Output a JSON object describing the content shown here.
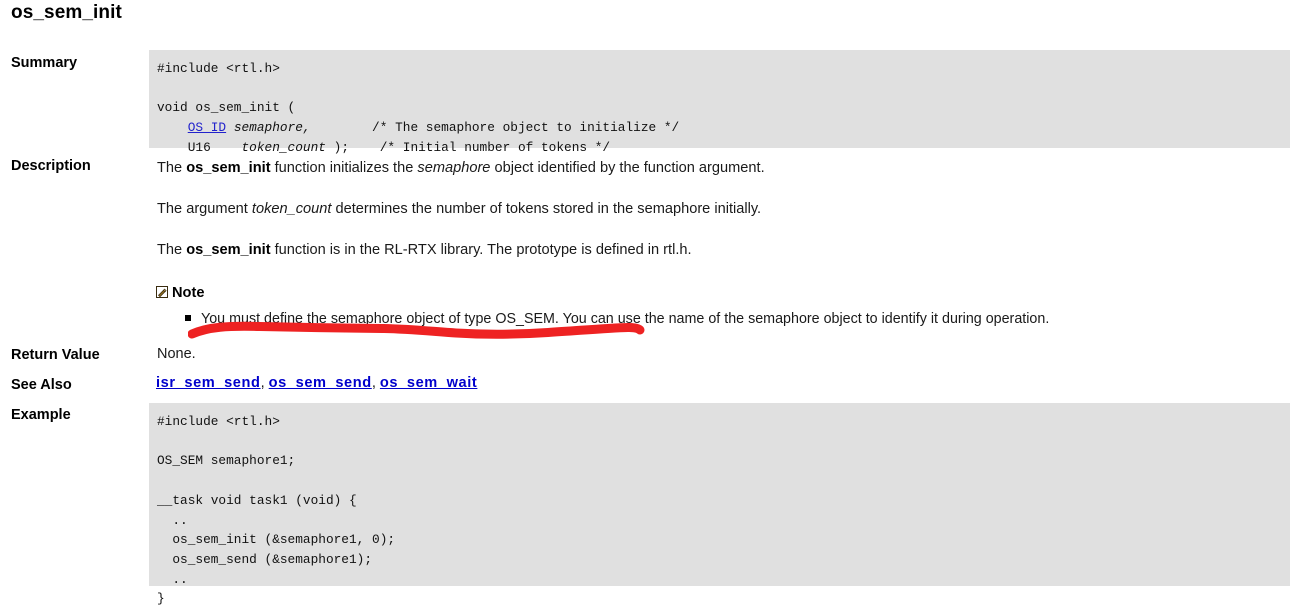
{
  "page": {
    "title": "os_sem_init"
  },
  "sections": {
    "summary": {
      "label": "Summary",
      "code_lines": [
        "#include <rtl.h>",
        "",
        "void os_sem_init (",
        "    OS_ID semaphore,        /* The semaphore object to initialize */",
        "    U16    token_count );    /* Initial number of tokens */"
      ],
      "link_text": "OS_ID"
    },
    "description": {
      "label": "Description",
      "paragraphs": [
        {
          "prefix": "The ",
          "bold": "os_sem_init",
          "mid": " function initializes the ",
          "italic": "semaphore",
          "suffix": " object identified by the function argument."
        },
        {
          "prefix": "The argument ",
          "bold": "",
          "mid": "",
          "italic": "token_count",
          "suffix": " determines the number of tokens stored in the semaphore initially."
        },
        {
          "prefix": "The ",
          "bold": "os_sem_init",
          "mid": " function is in the RL-RTX library. The prototype is defined in rtl.h.",
          "italic": "",
          "suffix": ""
        }
      ],
      "note": {
        "heading": "Note",
        "icon": "note-pencil-icon",
        "items": [
          "You must define the semaphore object of type OS_SEM. You can use the name of the semaphore object to identify it during operation."
        ]
      }
    },
    "return_value": {
      "label": "Return Value",
      "value": "None."
    },
    "see_also": {
      "label": "See Also",
      "separator": ", ",
      "links": [
        "isr_sem_send",
        "os_sem_send",
        "os_sem_wait"
      ]
    },
    "example": {
      "label": "Example",
      "code_lines": [
        "#include <rtl.h>",
        "",
        "OS_SEM semaphore1;",
        "",
        "__task void task1 (void) {",
        "  ..",
        "  os_sem_init (&semaphore1, 0);",
        "  os_sem_send (&semaphore1);",
        "  ..",
        "}"
      ]
    }
  },
  "annotation": {
    "type": "freehand-underline",
    "color": "#ee2222",
    "target": "note-item-text"
  },
  "colors": {
    "code_background": "#e0e0e0",
    "link": "#0000cc",
    "code_link": "#2222cc",
    "text": "#1a1a1a",
    "annotation_red": "#ee2222"
  }
}
